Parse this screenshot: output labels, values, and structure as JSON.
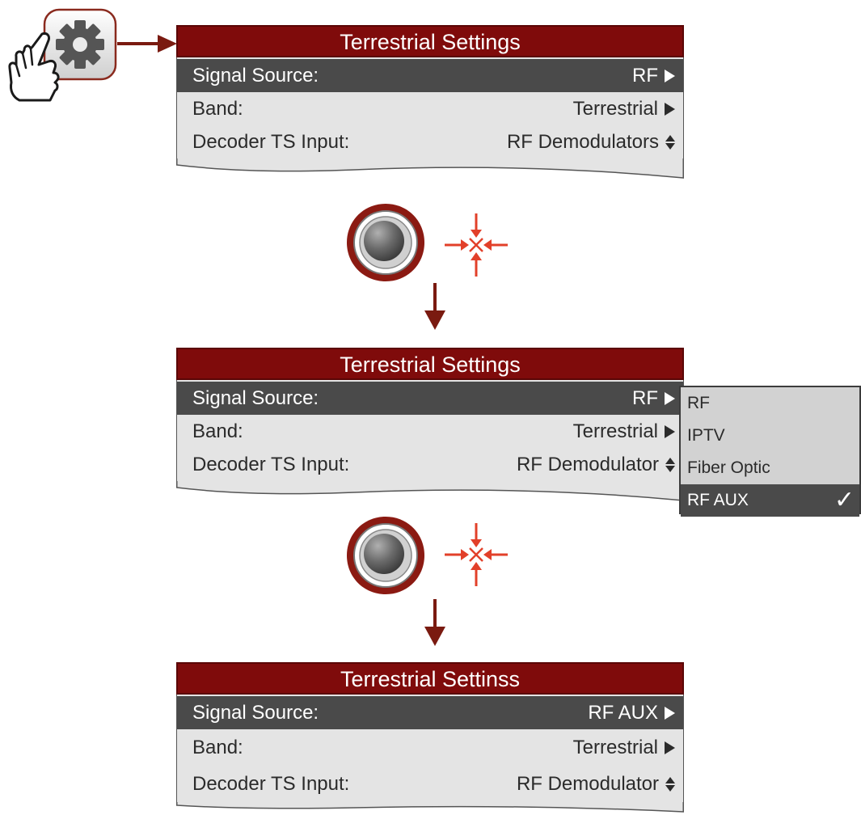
{
  "panels": [
    {
      "title": "Terrestrial Settings",
      "rows": [
        {
          "label": "Signal Source:",
          "value": "RF",
          "indicator": "arrow-right",
          "selected": true
        },
        {
          "label": "Band:",
          "value": "Terrestrial",
          "indicator": "arrow-right",
          "selected": false
        },
        {
          "label": "Decoder TS Input:",
          "value": "RF Demodulators",
          "indicator": "up-down",
          "selected": false
        }
      ]
    },
    {
      "title": "Terrestrial Settings",
      "rows": [
        {
          "label": "Signal Source:",
          "value": "RF",
          "indicator": "arrow-right",
          "selected": true
        },
        {
          "label": "Band:",
          "value": "Terrestrial",
          "indicator": "arrow-right",
          "selected": false
        },
        {
          "label": "Decoder TS Input:",
          "value": "RF Demodulator",
          "indicator": "up-down",
          "selected": false
        }
      ]
    },
    {
      "title": "Terrestrial Settinss",
      "rows": [
        {
          "label": "Signal Source:",
          "value": "RF AUX",
          "indicator": "arrow-right",
          "selected": true
        },
        {
          "label": "Band:",
          "value": "Terrestrial",
          "indicator": "arrow-right",
          "selected": false
        },
        {
          "label": "Decoder TS Input:",
          "value": "RF Demodulator",
          "indicator": "up-down",
          "selected": false
        }
      ]
    }
  ],
  "dropdown": {
    "options": [
      {
        "label": "RF",
        "selected": false
      },
      {
        "label": "IPTV",
        "selected": false
      },
      {
        "label": "Fiber Optic",
        "selected": false
      },
      {
        "label": "RF AUX",
        "selected": true,
        "mark": "✓"
      }
    ]
  },
  "icons": {
    "settings": "gear-icon",
    "hand": "hand-pointer-icon",
    "joystick": "joystick-button-icon",
    "press": "press-center-icon"
  },
  "colors": {
    "title_bar": "#7f0b0b",
    "selected_row": "#4a4a4a",
    "panel_body": "#e4e4e4",
    "arrow": "#7a1a10",
    "accent_red": "#e2402a"
  }
}
